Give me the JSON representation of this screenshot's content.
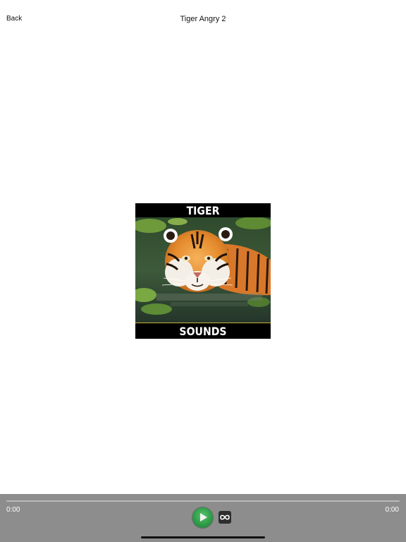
{
  "nav": {
    "back_label": "Back",
    "title": "Tiger Angry 2"
  },
  "artwork": {
    "top_text": "TIGER",
    "bottom_text": "SOUNDS"
  },
  "player": {
    "current_time": "0:00",
    "total_time": "0:00",
    "progress": 0,
    "play_icon": "play-icon",
    "loop_icon": "infinity-loop-icon",
    "accent_color": "#2e9d48"
  }
}
